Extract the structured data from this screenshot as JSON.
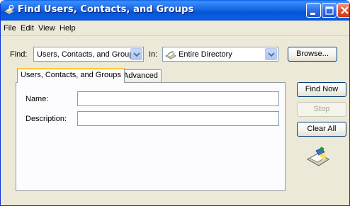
{
  "window": {
    "title": "Find Users, Contacts, and Groups"
  },
  "menu": [
    "File",
    "Edit",
    "View",
    "Help"
  ],
  "find": {
    "label": "Find:",
    "value": "Users, Contacts, and Groups",
    "in_label": "In:",
    "in_value": "Entire Directory",
    "browse_label": "Browse..."
  },
  "tabs": [
    "Users, Contacts, and Groups",
    "Advanced"
  ],
  "fields": {
    "name_label": "Name:",
    "name_value": "",
    "description_label": "Description:",
    "description_value": ""
  },
  "actions": {
    "find_now": "Find Now",
    "stop": "Stop",
    "clear_all": "Clear All"
  },
  "colors": {
    "title_bar": "#0a5fe0",
    "window_bg": "#ece9d8",
    "active_tab_accent": "#ffc83c",
    "close_button": "#e2593a"
  },
  "icons": {
    "title": "directory-search-icon",
    "in_value": "directory-book-icon",
    "animation": "search-flashlight-icon"
  }
}
